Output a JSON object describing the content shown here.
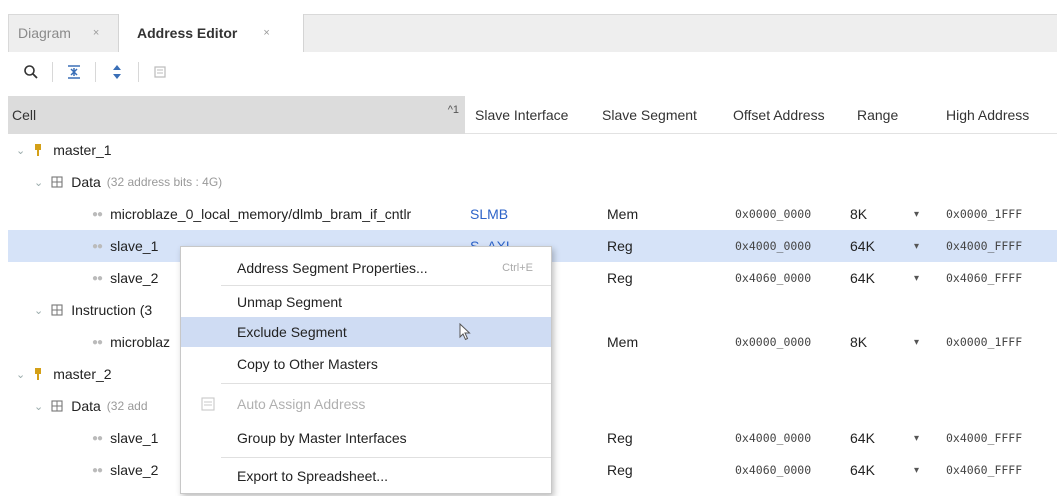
{
  "tabs": [
    {
      "label": "Diagram",
      "close": "×"
    },
    {
      "label": "Address Editor",
      "close": "×"
    }
  ],
  "toolbar": {
    "icons": [
      "search-icon",
      "collapse-all-icon",
      "expand-all-icon",
      "auto-assign-icon"
    ]
  },
  "table": {
    "headers": {
      "cell": "Cell",
      "sort": "^1",
      "slave_interface": "Slave Interface",
      "slave_segment": "Slave Segment",
      "offset": "Offset Address",
      "range": "Range",
      "high": "High Address"
    },
    "rows": [
      {
        "cell": "master_1"
      },
      {
        "cell": "Data",
        "note": "(32 address bits : 4G)"
      },
      {
        "cell": "microblaze_0_local_memory/dlmb_bram_if_cntlr",
        "iface": "SLMB",
        "segment": "Mem",
        "offset": "0x0000_0000",
        "range": "8K",
        "arrow": "▾",
        "high": "0x0000_1FFF"
      },
      {
        "cell": "slave_1",
        "iface": "S_AXI",
        "segment": "Reg",
        "offset": "0x4000_0000",
        "range": "64K",
        "arrow": "▾",
        "high": "0x4000_FFFF"
      },
      {
        "cell": "slave_2",
        "segment": "Reg",
        "offset": "0x4060_0000",
        "range": "64K",
        "arrow": "▾",
        "high": "0x4060_FFFF"
      },
      {
        "cell": "Instruction (3"
      },
      {
        "cell": "microblaz",
        "segment": "Mem",
        "offset": "0x0000_0000",
        "range": "8K",
        "arrow": "▾",
        "high": "0x0000_1FFF"
      },
      {
        "cell": "master_2"
      },
      {
        "cell": "Data",
        "note": "(32 add"
      },
      {
        "cell": "slave_1",
        "segment": "Reg",
        "offset": "0x4000_0000",
        "range": "64K",
        "arrow": "▾",
        "high": "0x4000_FFFF"
      },
      {
        "cell": "slave_2",
        "segment": "Reg",
        "offset": "0x4060_0000",
        "range": "64K",
        "arrow": "▾",
        "high": "0x4060_FFFF"
      }
    ]
  },
  "context_menu": {
    "items": [
      {
        "label": "Address Segment Properties...",
        "shortcut": "Ctrl+E"
      },
      {
        "label": "Unmap Segment"
      },
      {
        "label": "Exclude Segment"
      },
      {
        "label": "Copy to Other Masters"
      },
      {
        "label": "Auto Assign Address"
      },
      {
        "label": "Group by Master Interfaces"
      },
      {
        "label": "Export to Spreadsheet..."
      }
    ]
  },
  "colors": {
    "selection": "#d6e3f8",
    "menu_highlight": "#cfdcf3",
    "link": "#2d63c8"
  }
}
